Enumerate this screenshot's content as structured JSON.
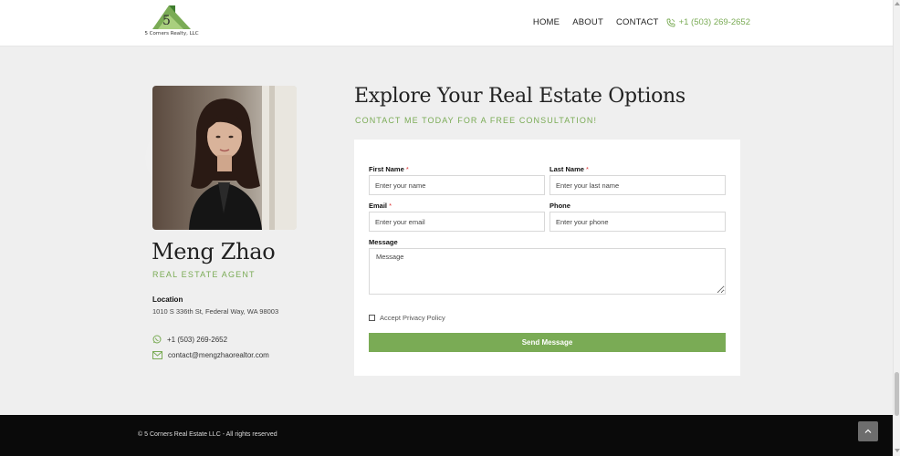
{
  "header": {
    "logo_text": "5 Corners Realty, LLC",
    "nav": [
      "HOME",
      "ABOUT",
      "CONTACT"
    ],
    "phone": "+1 (503) 269-2652",
    "phone_icon": "phone-icon"
  },
  "agent": {
    "name": "Meng Zhao",
    "title": "REAL ESTATE AGENT",
    "location_label": "Location",
    "location": "1010 S 336th St, Federal Way, WA 98003",
    "phone": "+1 (503) 269-2652",
    "phone_icon": "whatsapp-icon",
    "email": "contact@mengzhaorealtor.com",
    "email_icon": "envelope-icon"
  },
  "form": {
    "heading": "Explore Your Real Estate Options",
    "subheading": "CONTACT ME TODAY FOR A FREE CONSULTATION!",
    "first_name_label": "First Name",
    "first_name_placeholder": "Enter your name",
    "last_name_label": "Last Name",
    "last_name_placeholder": "Enter your last name",
    "email_label": "Email",
    "email_placeholder": "Enter your email",
    "phone_label": "Phone",
    "phone_placeholder": "Enter your phone",
    "message_label": "Message",
    "message_placeholder": "Message",
    "required_mark": "*",
    "privacy_label": "Accept Privacy Policy",
    "submit_label": "Send Message"
  },
  "footer": {
    "copyright": "© 5 Corners Real Estate LLC - All rights reserved",
    "to_top_icon": "chevron-up-icon"
  },
  "colors": {
    "accent": "#7aab55",
    "footer_bg": "#0a0a0a",
    "page_bg": "#efefef"
  }
}
